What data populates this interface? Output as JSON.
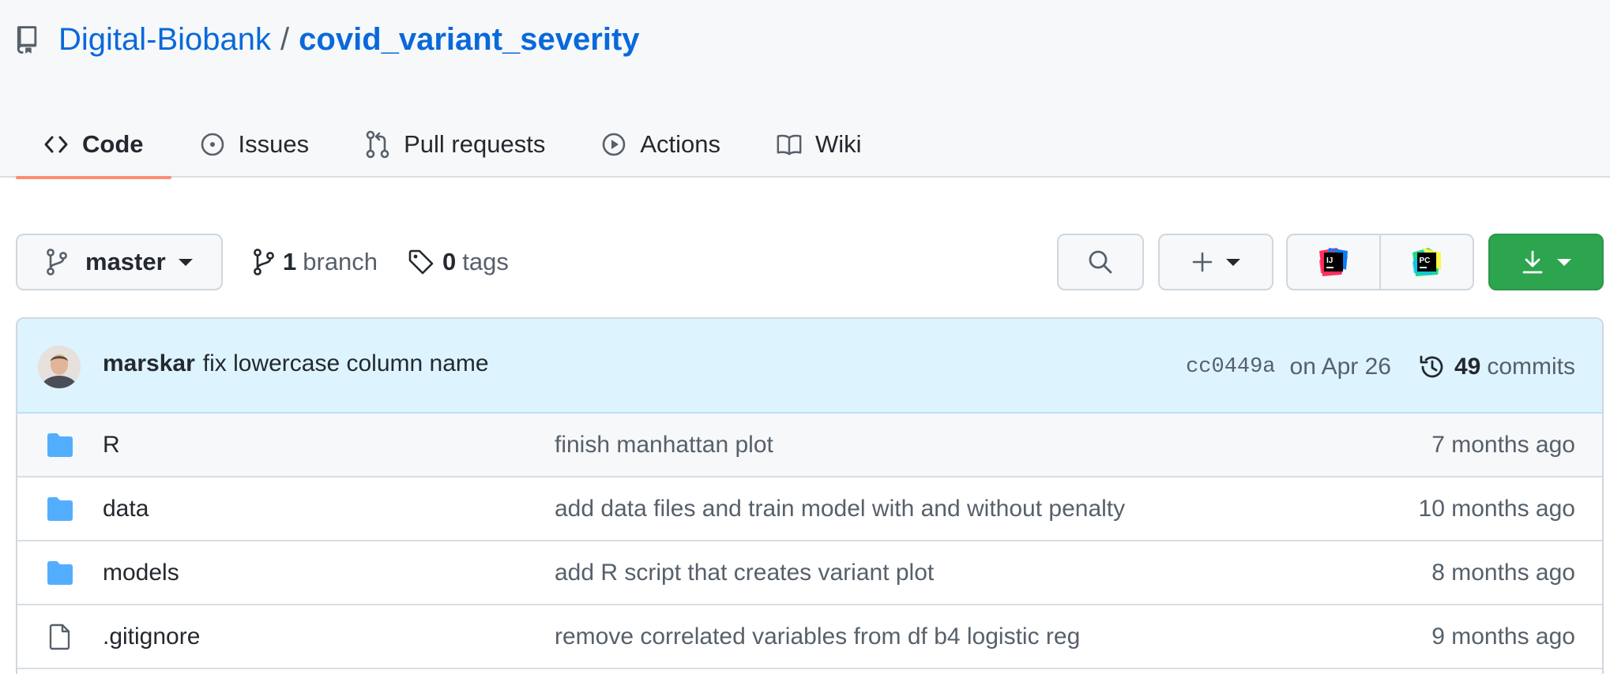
{
  "repo": {
    "owner": "Digital-Biobank",
    "separator": "/",
    "name": "covid_variant_severity"
  },
  "tabs": [
    {
      "label": "Code",
      "icon": "code-icon",
      "selected": true
    },
    {
      "label": "Issues",
      "icon": "issue-opened-icon",
      "selected": false
    },
    {
      "label": "Pull requests",
      "icon": "git-pull-request-icon",
      "selected": false
    },
    {
      "label": "Actions",
      "icon": "play-icon",
      "selected": false
    },
    {
      "label": "Wiki",
      "icon": "book-icon",
      "selected": false
    }
  ],
  "toolbar": {
    "branch": "master",
    "branches_count": "1",
    "branches_label": "branch",
    "tags_count": "0",
    "tags_label": "tags",
    "ide_1_label": "IJ",
    "ide_2_label": "PC"
  },
  "commit": {
    "author": "marskar",
    "message": "fix lowercase column name",
    "sha": "cc0449a",
    "date": "on Apr 26",
    "commits_count": "49",
    "commits_label": "commits"
  },
  "files": [
    {
      "name": "R",
      "type": "folder",
      "message": "finish manhattan plot",
      "age": "7 months ago"
    },
    {
      "name": "data",
      "type": "folder",
      "message": "add data files and train model with and without penalty",
      "age": "10 months ago"
    },
    {
      "name": "models",
      "type": "folder",
      "message": "add R script that creates variant plot",
      "age": "8 months ago"
    },
    {
      "name": ".gitignore",
      "type": "file",
      "message": "remove correlated variables from df b4 logistic reg",
      "age": "9 months ago"
    }
  ],
  "colors": {
    "link": "#0969da",
    "tab_underline": "#fd8c73",
    "primary_button": "#2da44e",
    "folder": "#54aeff",
    "commit_bar": "#ddf4ff"
  }
}
